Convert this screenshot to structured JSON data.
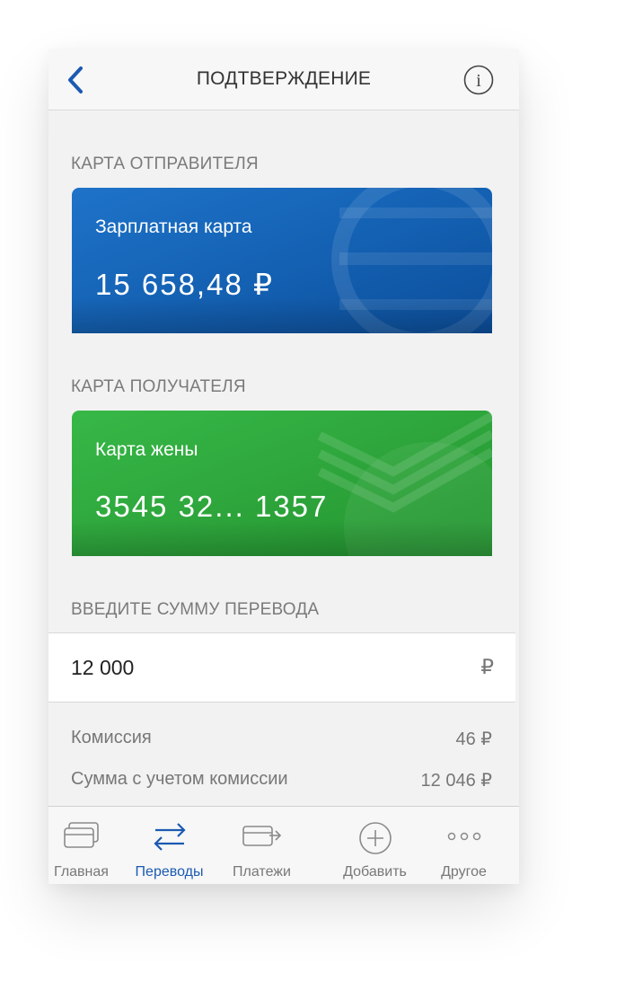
{
  "header": {
    "title": "ПОДТВЕРЖДЕНИЕ"
  },
  "sender": {
    "section_label": "КАРТА ОТПРАВИТЕЛЯ",
    "card_name": "Зарплатная карта",
    "card_value": "15 658,48 ₽",
    "color": "#1665b8"
  },
  "recipient": {
    "section_label": "КАРТА ПОЛУЧАТЕЛЯ",
    "card_name": "Карта жены",
    "card_value": "3545 32... 1357",
    "color": "#2ea63c"
  },
  "amount": {
    "section_label": "ВВЕДИТЕ СУММУ ПЕРЕВОДА",
    "value": "12 000",
    "currency": "₽"
  },
  "fees": {
    "commission_label": "Комиссия",
    "commission_value": "46 ₽",
    "total_label": "Сумма с учетом комиссии",
    "total_value": "12 046 ₽"
  },
  "tabbar": {
    "items": [
      {
        "label": "Главная",
        "icon": "cards-icon"
      },
      {
        "label": "Переводы",
        "icon": "transfer-arrows-icon",
        "active": true
      },
      {
        "label": "Платежи",
        "icon": "card-arrow-icon"
      },
      {
        "label": "Добавить",
        "icon": "plus-circle-icon"
      },
      {
        "label": "Другое",
        "icon": "more-dots-icon"
      }
    ],
    "active_color": "#1b5ab2"
  }
}
